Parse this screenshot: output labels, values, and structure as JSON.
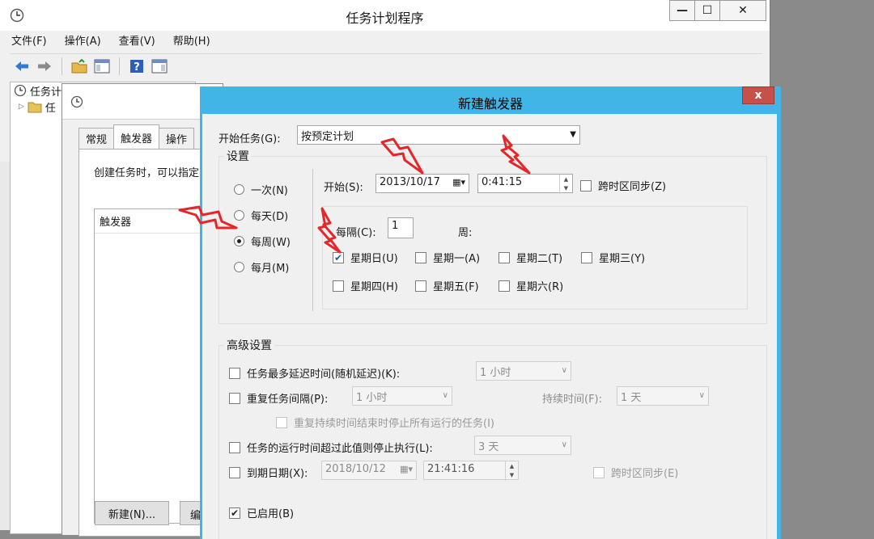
{
  "main": {
    "title": "任务计划程序",
    "menu": [
      "文件(F)",
      "操作(A)",
      "查看(V)",
      "帮助(H)"
    ],
    "tree": [
      "任务计",
      "任"
    ]
  },
  "task_dialog": {
    "tabs": [
      "常规",
      "触发器",
      "操作"
    ],
    "desc": "创建任务时，可以指定",
    "list_header": "触发器",
    "new_btn": "新建(N)...",
    "edit_btn": "编"
  },
  "trigger_dialog": {
    "title": "新建触发器",
    "close": "x",
    "start_task_label": "开始任务(G):",
    "start_task_value": "按预定计划",
    "settings_label": "设置",
    "radios": [
      {
        "label": "一次(N)",
        "checked": false
      },
      {
        "label": "每天(D)",
        "checked": false
      },
      {
        "label": "每周(W)",
        "checked": true
      },
      {
        "label": "每月(M)",
        "checked": false
      }
    ],
    "start_label": "开始(S):",
    "start_date": "2013/10/17",
    "start_time": "0:41:15",
    "sync_tz": "跨时区同步(Z)",
    "every_label": "每隔(C):",
    "every_value": "1",
    "week_label": "周:",
    "days": [
      {
        "label": "星期日(U)",
        "checked": true
      },
      {
        "label": "星期一(A)",
        "checked": false
      },
      {
        "label": "星期二(T)",
        "checked": false
      },
      {
        "label": "星期三(Y)",
        "checked": false
      },
      {
        "label": "星期四(H)",
        "checked": false
      },
      {
        "label": "星期五(F)",
        "checked": false
      },
      {
        "label": "星期六(R)",
        "checked": false
      }
    ],
    "advanced_label": "高级设置",
    "delay_label": "任务最多延迟时间(随机延迟)(K):",
    "delay_value": "1 小时",
    "repeat_label": "重复任务间隔(P):",
    "repeat_value": "1 小时",
    "duration_label": "持续时间(F):",
    "duration_value": "1 天",
    "stop_repeat_label": "重复持续时间结束时停止所有运行的任务(I)",
    "stop_exceed_label": "任务的运行时间超过此值则停止执行(L):",
    "stop_exceed_value": "3 天",
    "expire_label": "到期日期(X):",
    "expire_date": "2018/10/12",
    "expire_time": "21:41:16",
    "expire_sync": "跨时区同步(E)",
    "enabled_label": "已启用(B)",
    "enabled_checked": true
  },
  "colors": {
    "dialog_frame": "#41b6e6",
    "close_button": "#c7504a",
    "arrow": "#e5262b"
  }
}
